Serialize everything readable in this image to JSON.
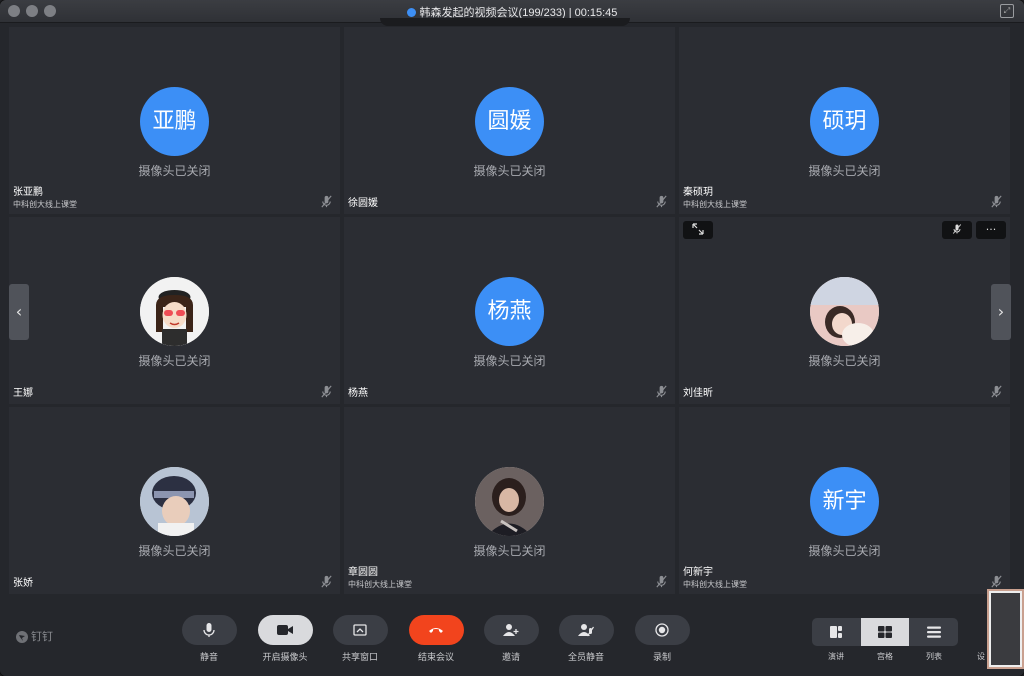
{
  "titlebar": {
    "title": "韩森发起的视频会议(199/233) | 00:15:45"
  },
  "tile_common": {
    "camera_off": "摄像头已关闭"
  },
  "tiles": [
    {
      "initials": "亚鹏",
      "name": "张亚鹏",
      "org": "中科创大线上课堂",
      "avatar_type": "initials"
    },
    {
      "initials": "圆媛",
      "name": "徐圆媛",
      "org": "",
      "avatar_type": "initials"
    },
    {
      "initials": "硕玥",
      "name": "秦硕玥",
      "org": "中科创大线上课堂",
      "avatar_type": "initials"
    },
    {
      "initials": "",
      "name": "王娜",
      "org": "",
      "avatar_type": "photo-cartoon-girl"
    },
    {
      "initials": "杨燕",
      "name": "杨燕",
      "org": "",
      "avatar_type": "initials"
    },
    {
      "initials": "",
      "name": "刘佳昕",
      "org": "",
      "avatar_type": "photo-girl"
    },
    {
      "initials": "",
      "name": "张娇",
      "org": "",
      "avatar_type": "photo-helmet"
    },
    {
      "initials": "",
      "name": "章圆圆",
      "org": "中科创大线上课堂",
      "avatar_type": "photo-woman"
    },
    {
      "initials": "新宇",
      "name": "何新宇",
      "org": "中科创大线上课堂",
      "avatar_type": "initials"
    }
  ],
  "tile_tools": {
    "more": "···"
  },
  "nav": {
    "prev": "‹",
    "next": "›"
  },
  "toolbar": {
    "brand": "钉钉",
    "buttons": [
      {
        "label": "静音",
        "icon": "microphone-icon"
      },
      {
        "label": "开启摄像头",
        "icon": "camera-icon"
      },
      {
        "label": "共享窗口",
        "icon": "share-screen-icon"
      },
      {
        "label": "结束会议",
        "icon": "hang-up-icon"
      },
      {
        "label": "邀请",
        "icon": "invite-user-icon"
      },
      {
        "label": "全员静音",
        "icon": "mute-all-icon"
      },
      {
        "label": "录制",
        "icon": "record-icon"
      }
    ],
    "layouts": [
      {
        "label": "演讲",
        "icon": "speaker-layout-icon"
      },
      {
        "label": "宫格",
        "icon": "grid-layout-icon",
        "active": true
      },
      {
        "label": "列表",
        "icon": "list-layout-icon"
      }
    ],
    "settings_label": "设"
  },
  "colors": {
    "accent": "#3c8ff6",
    "end_call": "#f2441d",
    "tile_bg": "#2b2d33"
  }
}
